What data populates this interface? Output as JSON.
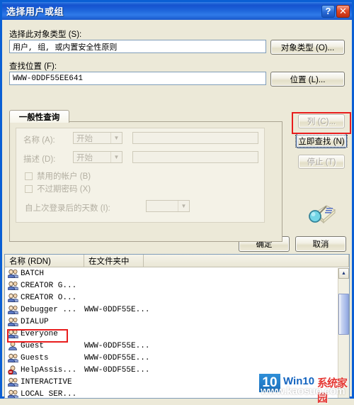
{
  "window": {
    "title": "选择用户或组",
    "help_button": "?",
    "close_button": "✕"
  },
  "object_type": {
    "label": "选择此对象类型 (S):",
    "value": "用户, 组, 或内置安全性原则",
    "button": "对象类型 (O)..."
  },
  "location": {
    "label": "查找位置 (F):",
    "value": "WWW-0DDF55EE641",
    "button": "位置 (L)..."
  },
  "tab": {
    "label": "一般性查询"
  },
  "query": {
    "name_label": "名称 (A):",
    "name_condition": "开始",
    "name_value": "",
    "desc_label": "描述 (D):",
    "desc_condition": "开始",
    "desc_value": "",
    "disabled_accounts": "禁用的帐户 (B)",
    "non_expiring_password": "不过期密码 (X)",
    "days_since_logon_label": "自上次登录后的天数 (I):",
    "days_since_logon_value": ""
  },
  "side_buttons": {
    "columns": "列 (C)...",
    "find_now": "立即查找 (N)",
    "stop": "停止 (T)",
    "search_icon": "find-magnifier-icon"
  },
  "dialog_buttons": {
    "ok": "确定",
    "cancel": "取消"
  },
  "results": {
    "columns": [
      "名称 (RDN)",
      "在文件夹中",
      ""
    ],
    "rows": [
      {
        "name": "BATCH",
        "folder": "",
        "icon": "group-icon",
        "selected": false
      },
      {
        "name": "CREATOR G...",
        "folder": "",
        "icon": "group-icon",
        "selected": false
      },
      {
        "name": "CREATOR O...",
        "folder": "",
        "icon": "group-icon",
        "selected": false
      },
      {
        "name": "Debugger ...",
        "folder": "WWW-0DDF55E...",
        "icon": "group-icon",
        "selected": false
      },
      {
        "name": "DIALUP",
        "folder": "",
        "icon": "group-icon",
        "selected": false
      },
      {
        "name": "Everyone",
        "folder": "",
        "icon": "group-icon",
        "selected": true
      },
      {
        "name": "Guest",
        "folder": "WWW-0DDF55E...",
        "icon": "user-icon",
        "selected": false
      },
      {
        "name": "Guests",
        "folder": "WWW-0DDF55E...",
        "icon": "group-icon",
        "selected": false
      },
      {
        "name": "HelpAssis...",
        "folder": "WWW-0DDF55E...",
        "icon": "user-disabled-icon",
        "selected": false
      },
      {
        "name": "INTERACTIVE",
        "folder": "",
        "icon": "group-icon",
        "selected": false
      },
      {
        "name": "LOCAL SER...",
        "folder": "",
        "icon": "group-icon",
        "selected": false
      }
    ]
  },
  "watermark": {
    "badge": "10",
    "brand": "Win10",
    "brand_cn": "系统家园",
    "url": "www.kaosuo.com"
  },
  "colors": {
    "titlebar": "#1553cf",
    "face": "#ece9d8",
    "annotation": "#e81d1d",
    "field_border": "#7f9db9"
  }
}
